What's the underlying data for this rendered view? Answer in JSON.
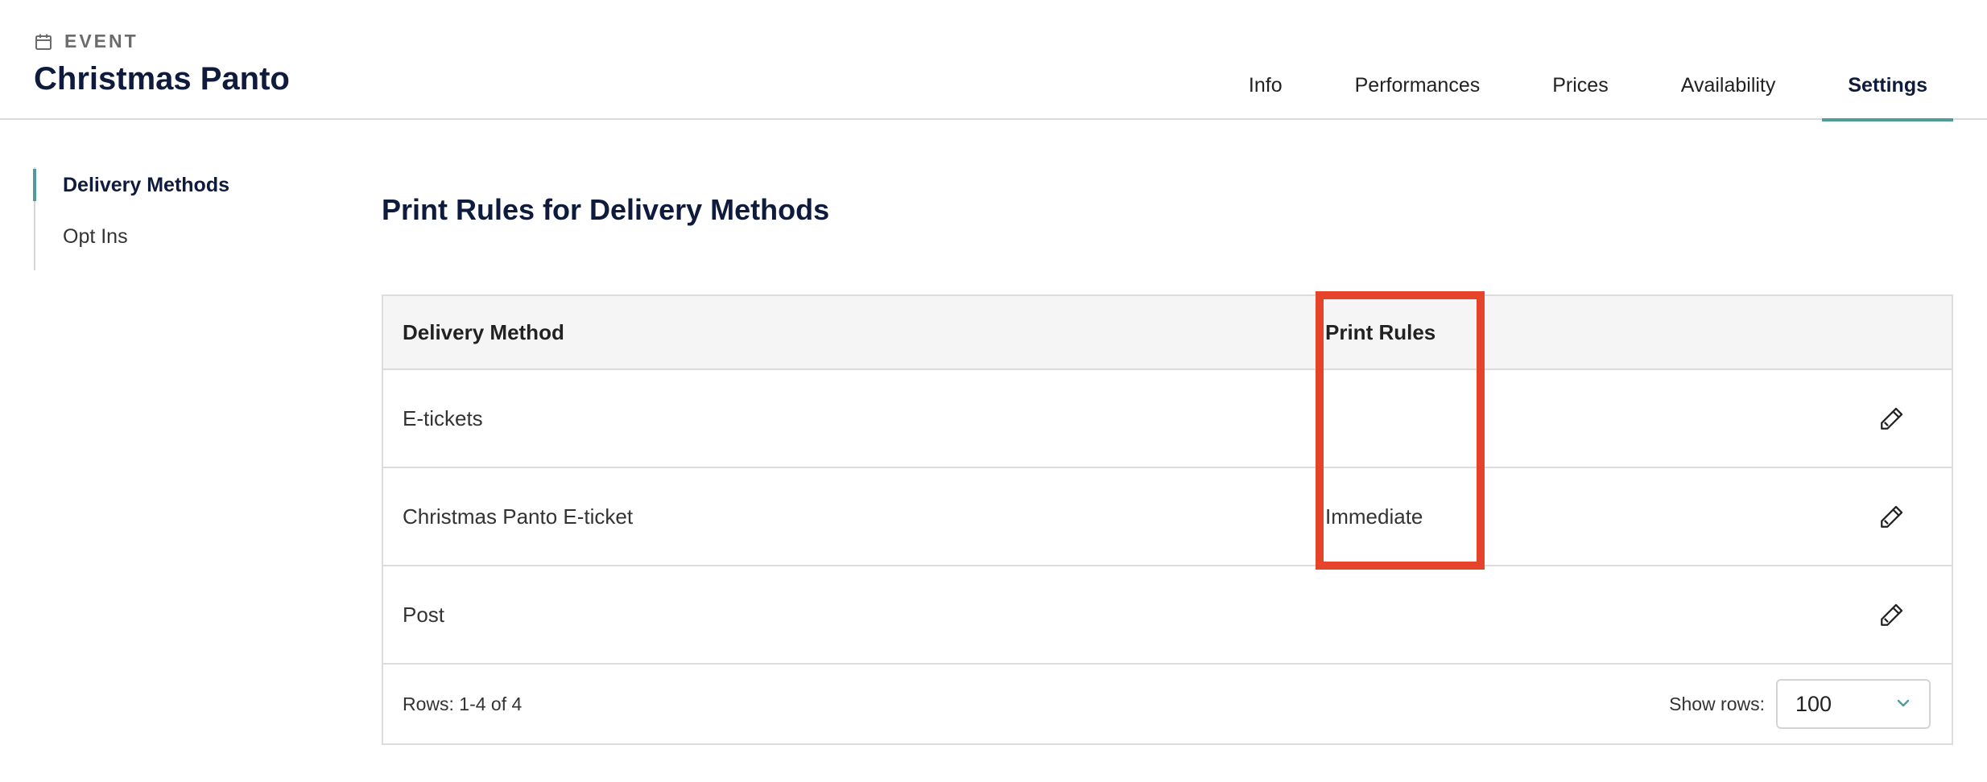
{
  "header": {
    "eyebrow": "EVENT",
    "title": "Christmas Panto",
    "tabs": [
      {
        "label": "Info",
        "active": false
      },
      {
        "label": "Performances",
        "active": false
      },
      {
        "label": "Prices",
        "active": false
      },
      {
        "label": "Availability",
        "active": false
      },
      {
        "label": "Settings",
        "active": true
      }
    ]
  },
  "sidebar": {
    "items": [
      {
        "label": "Delivery Methods",
        "active": true
      },
      {
        "label": "Opt Ins",
        "active": false
      }
    ]
  },
  "main": {
    "title": "Print Rules for Delivery Methods",
    "table": {
      "headers": [
        "Delivery Method",
        "Print Rules"
      ],
      "rows": [
        {
          "method": "E-tickets",
          "rule": ""
        },
        {
          "method": "Christmas Panto E-ticket",
          "rule": "Immediate"
        },
        {
          "method": "Post",
          "rule": ""
        }
      ],
      "rows_summary": "Rows: 1-4 of 4",
      "show_rows_label": "Show rows:",
      "show_rows_value": "100"
    }
  },
  "colors": {
    "accent": "#4f9c9a",
    "title": "#0f1b3d",
    "highlight": "#e5432a"
  },
  "icons": [
    "calendar-icon",
    "pencil-icon",
    "chevron-down-icon"
  ]
}
